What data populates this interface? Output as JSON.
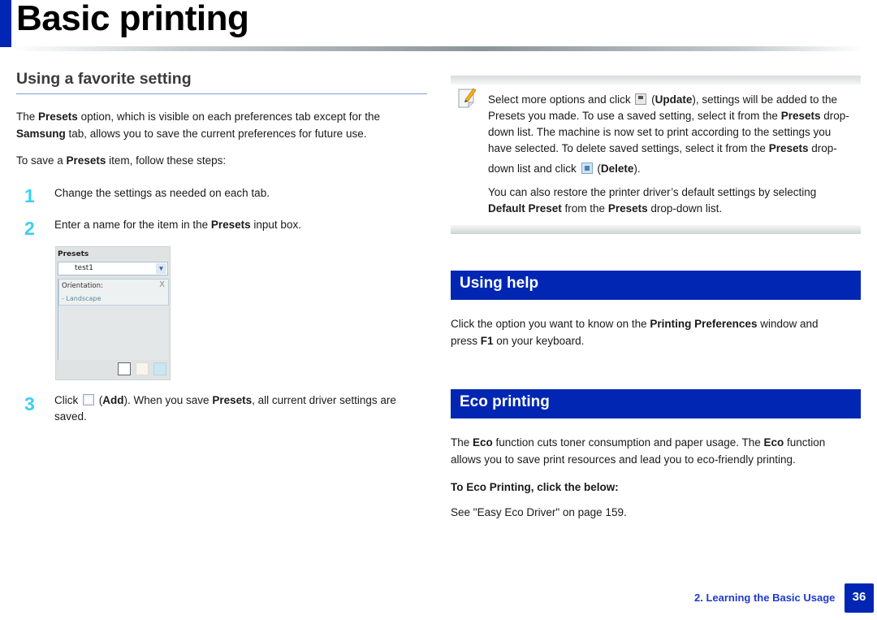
{
  "page": {
    "title": "Basic printing",
    "colors": {
      "brand_blue": "#0026b3",
      "step_number": "#3ad0f0",
      "footer_text": "#1f3ad0"
    }
  },
  "favorite": {
    "heading": "Using a favorite setting",
    "intro": {
      "t1": "The ",
      "b1": "Presets",
      "t2": " option, which is visible on each preferences tab except for the",
      "b2": "Samsung",
      "t3": " tab, allows you to save the current preferences for future use."
    },
    "save_line": {
      "t1": "To save a ",
      "b1": "Presets",
      "t2": " item, follow these steps:"
    },
    "steps": [
      {
        "num": "1",
        "text": "Change the settings as needed on each tab."
      },
      {
        "num": "2",
        "t1": "Enter a name for the item in the ",
        "b1": "Presets",
        "t2": " input box."
      },
      {
        "num": "3",
        "t1": "Click ",
        "icon": "add-icon",
        "b1": "Add",
        "t2": "). When you save ",
        "b2": "Presets",
        "t3": ", all current driver settings are",
        "t4": "saved.",
        "paren_open": " ("
      }
    ],
    "screenshot": {
      "label": "Presets",
      "selected_value": "test1",
      "item_name": "Orientation:",
      "item_value": "- Landscape",
      "remove_glyph": "X",
      "dropdown_glyph": "⌵",
      "buttons": [
        "add-icon",
        "update-icon",
        "delete-icon"
      ]
    }
  },
  "note": {
    "icon": "note-pencil-icon",
    "line1": {
      "t1": "Select more options and click",
      "paren_open": " (",
      "b1": "Update",
      "t2": "), settings will be added to the"
    },
    "line2": {
      "t1": "Presets you made. To use a saved setting, select it from the ",
      "b1": "Presets",
      "t2": " drop-"
    },
    "line3": "down list. The machine is now set to print according to the settings you",
    "line4": {
      "t1": "have selected. To delete saved settings, select it from the ",
      "b1": "Presets",
      "t2": " drop-"
    },
    "line5": {
      "t1": "down list and click",
      "paren_open": " (",
      "b1": "Delete",
      "t2": ")."
    },
    "line6": "You can also restore the printer driver’s default settings by selecting",
    "line7": {
      "b1": "Default Preset",
      "t1": " from the ",
      "b2": "Presets",
      "t2": " drop-down list."
    }
  },
  "help": {
    "heading": "Using help",
    "line1": {
      "t1": "Click the option you want to know on the ",
      "b1": "Printing Preferences",
      "t2": " window and"
    },
    "line2": {
      "t1": "press ",
      "b1": "F1",
      "t2": " on your keyboard."
    }
  },
  "eco": {
    "heading": "Eco printing",
    "line1": {
      "t1": "The ",
      "b1": "Eco",
      "t2": " function cuts toner consumption and paper usage. The ",
      "b2": "Eco",
      "t3": " function"
    },
    "line2": "allows you to save print resources and lead you to eco-friendly printing.",
    "subheading": "To Eco Printing, click the below:",
    "link_line": "See \"Easy Eco Driver\" on page 159."
  },
  "footer": {
    "chapter": "2. Learning the Basic Usage",
    "page_number": "36"
  }
}
